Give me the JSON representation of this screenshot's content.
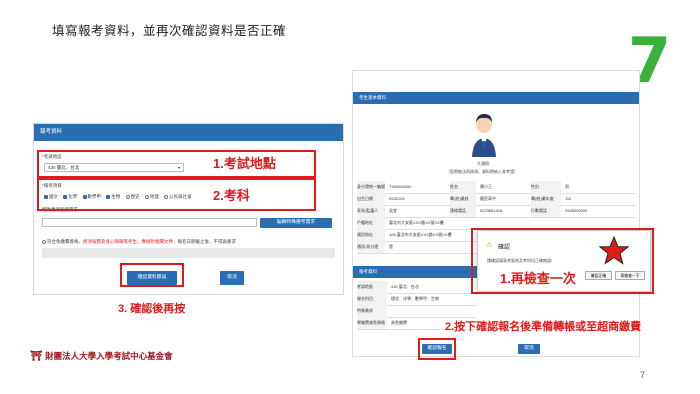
{
  "slide": {
    "title": "填寫報考資料，並再次確認資料是否正確",
    "step_number": "7",
    "page_number": "7",
    "logo_text": "財團法人大學入學考試中心基金會"
  },
  "left_form": {
    "header": "報考資料",
    "exam_area_label": "*考試地區",
    "exam_area_value": "430 臺北．台北",
    "subjects_label": "*報考項目",
    "subjects": [
      {
        "label": "國文",
        "checked": true
      },
      {
        "label": "化學",
        "checked": true
      },
      {
        "label": "數學甲",
        "checked": true
      },
      {
        "label": "生物",
        "checked": true
      },
      {
        "label": "歷史",
        "checked": false
      },
      {
        "label": "地理",
        "checked": false
      },
      {
        "label": "公民與社會",
        "checked": false
      }
    ],
    "special_label": "特殊應考服務需求",
    "special_button": "編輯特殊應考需求",
    "disability_check": "符合免繳費資格",
    "disability_note": "，經濟弱勢及身心障礙等考生，應檢附相關文件",
    "disability_note2": "，報名日期截止後，不得再要求",
    "confirm_button": "確認資料無誤",
    "cancel_button": "取消"
  },
  "annotations": {
    "area": "1.考試地點",
    "subjects": "2.考科",
    "confirm_again": "3. 確認後再按",
    "recheck": "1.再檢查一次",
    "final": "2.按下確認報名後準備轉帳或至超商繳費"
  },
  "right_form": {
    "header1": "考生基本資料",
    "photo_caption": "大頭照",
    "photo_note": "（您將無法再修改，資料將納入准考證）",
    "rows": [
      [
        "身分證統一編號",
        "T200000000",
        "姓名",
        "陳小王",
        "性別",
        "男"
      ],
      [
        "出生日期",
        "0930104",
        "畢(結)業校",
        "健民高中",
        "畢(結)業年度",
        "112"
      ],
      [
        "家長/監護人",
        "吳宜",
        "連絡電話",
        "0223661416",
        "行動電話",
        "0908000000"
      ],
      [
        "戶籍地址",
        "臺北市大安區XXX路XX號XX樓",
        "",
        "",
        "",
        ""
      ],
      [
        "通訊地址",
        "106 臺北市大安區XXX路XX號XX樓",
        "",
        "",
        "",
        ""
      ],
      [
        "通訊/身分證",
        "是",
        "",
        "",
        "",
        ""
      ]
    ],
    "header2": "報考資料",
    "exam_rows": [
      [
        "考試地區",
        "430 臺北．台北"
      ],
      [
        "報名科目",
        "理化．化學．數學甲．生物"
      ],
      [
        "特殊需求",
        ""
      ],
      [
        "學雜費減免資格",
        "具免繳費"
      ]
    ],
    "confirm_button": "確認報名",
    "cancel_button": "取消"
  },
  "dialog": {
    "title": "確認",
    "message": "請確認填寫考區地及考科均正確無誤!",
    "confirm_button": "確認正確",
    "recheck_button": "再檢查一下"
  }
}
